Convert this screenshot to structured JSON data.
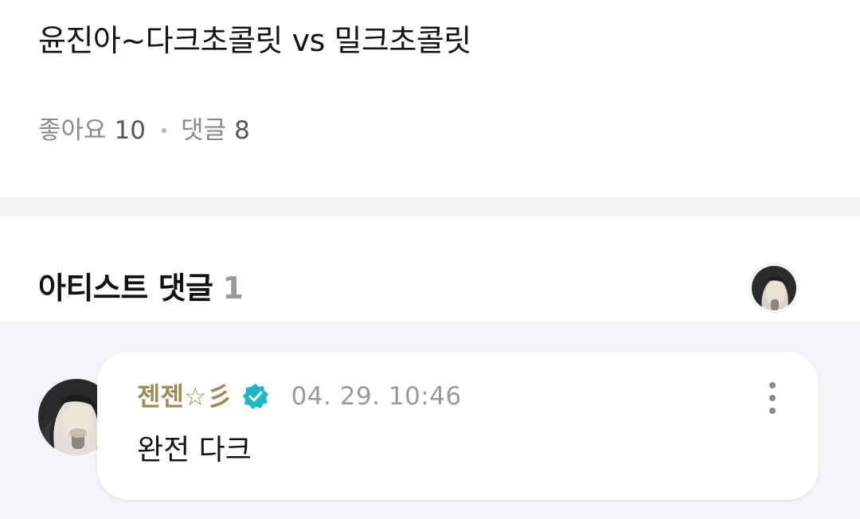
{
  "post": {
    "title": "윤진아~다크초콜릿 vs 밀크초콜릿",
    "likes_label": "좋아요",
    "likes_count": "10",
    "comments_label": "댓글",
    "comments_count": "8"
  },
  "artist_comments": {
    "title": "아티스트 댓글",
    "count": "1",
    "header_avatar_icon": "artist-avatar"
  },
  "comment": {
    "author": "젠젠☆彡",
    "verified_icon": "verified-badge-icon",
    "time": "04. 29. 10:46",
    "text": "완전 다크",
    "more_icon": "more-vertical-icon"
  },
  "colors": {
    "author_name": "#a08b58",
    "verified": "#1cb8c8",
    "divider": "#f3f3f3",
    "comments_bg": "#f3f5f8"
  }
}
